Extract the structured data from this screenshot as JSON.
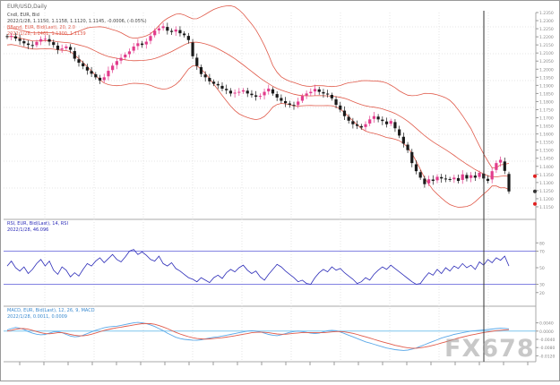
{
  "window": {
    "title": "EUR/USD,Daily"
  },
  "header": {
    "price_line": "Cndl, EUR, Bid",
    "price_values": "2022/1/28, 1.1150, 1.1158, 1.1120, 1.1145, -0.0006, (-0.05%)",
    "bb_line": "BBand, EUR, Bid(Last), 20, 2.0",
    "bb_values": "2022/1/28, 1.1461, 1.1300, 1.1139"
  },
  "rsi_header": {
    "line1": "RSI, EUR, Bid(Last), 14, RSI",
    "line2": "2022/1/28, 46.096"
  },
  "macd_header": {
    "line1": "MACD, EUR, Bid(Last), 12, 26, 9, MACD",
    "line2": "2022/1/28, 0.0011, 0.0009"
  },
  "watermark": "FX678",
  "colors": {
    "up_candle": "#e23c8c",
    "down_candle": "#1a1a1a",
    "bollinger": "#e05a4a",
    "rsi_line": "#2c2cb8",
    "rsi_levels": "#5a5ad8",
    "macd_main": "#5aa8e8",
    "macd_signal": "#e05a4a",
    "macd_zero": "#7fc6ee",
    "cursor": "#333333",
    "marker_red": "#e02020",
    "marker_dark": "#333333"
  },
  "chart_data": [
    {
      "type": "candlestick",
      "title": "EUR/USD,Daily",
      "ylim": [
        1.11,
        1.235
      ],
      "y_ticks": [
        "1.2350",
        "1.2300",
        "1.2250",
        "1.2200",
        "1.2150",
        "1.2100",
        "1.2050",
        "1.2000",
        "1.1950",
        "1.1900",
        "1.1850",
        "1.1800",
        "1.1750",
        "1.1700",
        "1.1650",
        "1.1600",
        "1.1550",
        "1.1500",
        "1.1450",
        "1.1400",
        "1.1350",
        "1.1300",
        "1.1250",
        "1.1200",
        "1.1150"
      ],
      "close": [
        1.22,
        1.2205,
        1.219,
        1.2175,
        1.216,
        1.215,
        1.2145,
        1.2168,
        1.2185,
        1.2188,
        1.217,
        1.215,
        1.212,
        1.2128,
        1.214,
        1.212,
        1.2065,
        1.204,
        1.2018,
        1.1992,
        1.1972,
        1.195,
        1.193,
        1.195,
        1.199,
        1.2022,
        1.205,
        1.207,
        1.209,
        1.211,
        1.214,
        1.216,
        1.215,
        1.217,
        1.2205,
        1.2238,
        1.2252,
        1.2265,
        1.2238,
        1.223,
        1.2245,
        1.2222,
        1.221,
        1.218,
        1.208,
        1.202,
        1.197,
        1.195,
        1.1925,
        1.191,
        1.19,
        1.188,
        1.187,
        1.185,
        1.1855,
        1.186,
        1.187,
        1.185,
        1.184,
        1.183,
        1.1835,
        1.186,
        1.188,
        1.185,
        1.1825,
        1.1805,
        1.179,
        1.178,
        1.1775,
        1.18,
        1.1835,
        1.185,
        1.186,
        1.1878,
        1.186,
        1.185,
        1.1845,
        1.182,
        1.178,
        1.175,
        1.171,
        1.1682,
        1.166,
        1.165,
        1.164,
        1.166,
        1.169,
        1.171,
        1.169,
        1.168,
        1.166,
        1.168,
        1.1635,
        1.159,
        1.154,
        1.15,
        1.142,
        1.137,
        1.133,
        1.129,
        1.132,
        1.131,
        1.1335,
        1.1325,
        1.1322,
        1.1318,
        1.133,
        1.131,
        1.135,
        1.1325,
        1.1345,
        1.133,
        1.136,
        1.1325,
        1.131,
        1.137,
        1.142,
        1.144,
        1.1372,
        1.1245
      ]
    },
    {
      "type": "line",
      "title": "RSI, EUR, Bid(Last), 14, RSI",
      "ylim": [
        10,
        90
      ],
      "y_ticks": [
        "80",
        "70",
        "50",
        "30",
        "20"
      ],
      "levels": [
        70,
        30
      ],
      "series": [
        {
          "name": "RSI",
          "values": [
            52,
            58,
            50,
            46,
            51,
            43,
            48,
            55,
            60,
            52,
            58,
            47,
            42,
            51,
            47,
            39,
            44,
            40,
            48,
            55,
            52,
            58,
            62,
            56,
            61,
            66,
            60,
            57,
            63,
            70,
            72,
            66,
            69,
            65,
            60,
            58,
            64,
            55,
            52,
            56,
            49,
            46,
            42,
            38,
            36,
            33,
            38,
            35,
            32,
            38,
            41,
            37,
            44,
            48,
            45,
            50,
            53,
            47,
            43,
            46,
            39,
            35,
            42,
            48,
            54,
            51,
            46,
            42,
            38,
            33,
            35,
            31,
            30,
            38,
            44,
            48,
            45,
            51,
            47,
            49,
            44,
            40,
            36,
            31,
            33,
            38,
            35,
            42,
            47,
            51,
            48,
            53,
            49,
            45,
            41,
            37,
            33,
            30,
            31,
            38,
            44,
            41,
            48,
            43,
            50,
            46,
            52,
            49,
            55,
            50,
            53,
            48,
            57,
            53,
            60,
            56,
            62,
            59,
            64,
            52
          ]
        }
      ]
    },
    {
      "type": "line",
      "title": "MACD, EUR, Bid(Last), 12, 26, 9, MACD",
      "ylim": [
        -0.014,
        0.006
      ],
      "y_ticks": [
        "0.0040",
        "0.0000",
        "-0.0040",
        "-0.0080",
        "-0.0120"
      ],
      "zero_line": 0.0,
      "series": [
        {
          "name": "MACD",
          "values": [
            0.0005,
            0.0012,
            0.0018,
            0.0014,
            0.0008,
            -0.0002,
            -0.001,
            -0.0015,
            -0.0018,
            -0.0016,
            -0.001,
            -0.0004,
            -0.0002,
            -0.0008,
            -0.0016,
            -0.0024,
            -0.0028,
            -0.0026,
            -0.002,
            -0.0012,
            -0.0004,
            0.0004,
            0.001,
            0.0016,
            0.002,
            0.0022,
            0.0024,
            0.0028,
            0.0032,
            0.0036,
            0.004,
            0.0042,
            0.004,
            0.0036,
            0.003,
            0.0022,
            0.0012,
            0.0002,
            -0.001,
            -0.002,
            -0.003,
            -0.0036,
            -0.004,
            -0.0042,
            -0.0044,
            -0.0045,
            -0.0042,
            -0.0038,
            -0.0034,
            -0.003,
            -0.0028,
            -0.0024,
            -0.002,
            -0.0016,
            -0.0012,
            -0.0008,
            -0.0004,
            0.0,
            0.0002,
            0.0,
            -0.0004,
            -0.001,
            -0.0016,
            -0.002,
            -0.0022,
            -0.0018,
            -0.0012,
            -0.0006,
            -0.0002,
            0.0,
            -0.0002,
            -0.0006,
            -0.001,
            -0.0012,
            -0.001,
            -0.0004,
            0.0002,
            0.0004,
            0.0002,
            -0.0004,
            -0.0012,
            -0.002,
            -0.0028,
            -0.0036,
            -0.0044,
            -0.0052,
            -0.0058,
            -0.0064,
            -0.007,
            -0.0076,
            -0.0082,
            -0.0086,
            -0.009,
            -0.0092,
            -0.0094,
            -0.0092,
            -0.0088,
            -0.0082,
            -0.0074,
            -0.0066,
            -0.0058,
            -0.005,
            -0.0042,
            -0.0034,
            -0.0028,
            -0.0022,
            -0.0016,
            -0.0012,
            -0.0008,
            -0.0004,
            0.0,
            0.0002,
            0.0004,
            0.0006,
            0.0008,
            0.001,
            0.0012,
            0.0014,
            0.0013,
            0.0011
          ]
        },
        {
          "name": "Signal",
          "values": [
            0.0,
            0.0004,
            0.0009,
            0.0012,
            0.0012,
            0.0009,
            0.0004,
            -0.0002,
            -0.0008,
            -0.0012,
            -0.0013,
            -0.0011,
            -0.0008,
            -0.0008,
            -0.0011,
            -0.0016,
            -0.002,
            -0.0023,
            -0.0023,
            -0.002,
            -0.0015,
            -0.0009,
            -0.0003,
            0.0003,
            0.0008,
            0.0012,
            0.0016,
            0.0019,
            0.0023,
            0.0026,
            0.003,
            0.0033,
            0.0036,
            0.0037,
            0.0036,
            0.0033,
            0.0027,
            0.002,
            0.0012,
            0.0003,
            -0.0006,
            -0.0014,
            -0.0021,
            -0.0027,
            -0.0032,
            -0.0036,
            -0.0038,
            -0.0039,
            -0.0038,
            -0.0036,
            -0.0034,
            -0.0032,
            -0.0029,
            -0.0026,
            -0.0023,
            -0.0019,
            -0.0015,
            -0.0012,
            -0.0008,
            -0.0006,
            -0.0005,
            -0.0006,
            -0.0008,
            -0.0011,
            -0.0014,
            -0.0015,
            -0.0015,
            -0.0013,
            -0.0011,
            -0.0009,
            -0.0007,
            -0.0007,
            -0.0007,
            -0.0008,
            -0.0008,
            -0.0008,
            -0.0006,
            -0.0004,
            -0.0002,
            -0.0002,
            -0.0004,
            -0.0007,
            -0.0011,
            -0.0016,
            -0.0022,
            -0.0028,
            -0.0034,
            -0.004,
            -0.0046,
            -0.0052,
            -0.0058,
            -0.0063,
            -0.0069,
            -0.0073,
            -0.0078,
            -0.0081,
            -0.0083,
            -0.0083,
            -0.0081,
            -0.0078,
            -0.0074,
            -0.0069,
            -0.0064,
            -0.0058,
            -0.0052,
            -0.0046,
            -0.004,
            -0.0034,
            -0.0029,
            -0.0024,
            -0.0019,
            -0.0015,
            -0.0011,
            -0.0007,
            -0.0004,
            -0.0001,
            0.0002,
            0.0004,
            0.0006,
            0.0007
          ]
        }
      ]
    }
  ]
}
